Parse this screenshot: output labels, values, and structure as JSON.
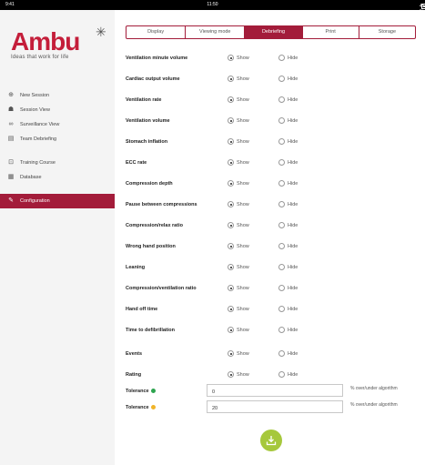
{
  "status": {
    "left": "9:41",
    "time": "11:50",
    "battery": "45 %"
  },
  "brand": {
    "name": "Ambu",
    "tagline": "Ideas that work for life"
  },
  "colors": {
    "brand": "#a31c3a",
    "save_button": "#a6c83c",
    "tolerance_green": "#2ea44f",
    "tolerance_yellow": "#f0b429"
  },
  "menu": [
    {
      "label": "New Session",
      "icon": "plus-circle-icon"
    },
    {
      "label": "Session View",
      "icon": "person-icon"
    },
    {
      "label": "Surveillance View",
      "icon": "binoculars-icon"
    },
    {
      "label": "Team Debriefing",
      "icon": "clipboard-icon"
    },
    {
      "label": "Training Course",
      "icon": "course-icon"
    },
    {
      "label": "Database",
      "icon": "database-icon"
    },
    {
      "label": "Configuration",
      "icon": "wrench-icon",
      "active": true
    }
  ],
  "tabs": [
    {
      "label": "Display"
    },
    {
      "label": "Viewing mode"
    },
    {
      "label": "Debriefing",
      "active": true
    },
    {
      "label": "Print"
    },
    {
      "label": "Storage"
    }
  ],
  "options": {
    "show": "Show",
    "hide": "Hide"
  },
  "rows": [
    {
      "label": "Ventilation minute volume",
      "value": "show"
    },
    {
      "label": "Cardiac output volume",
      "value": "show"
    },
    {
      "label": "Ventilation rate",
      "value": "show"
    },
    {
      "label": "Ventilation volume",
      "value": "show"
    },
    {
      "label": "Stomach inflation",
      "value": "show"
    },
    {
      "label": "ECC rate",
      "value": "show"
    },
    {
      "label": "Compression depth",
      "value": "show"
    },
    {
      "label": "Pause between compressions",
      "value": "show"
    },
    {
      "label": "Compression/relax ratio",
      "value": "show"
    },
    {
      "label": "Wrong hand position",
      "value": "show"
    },
    {
      "label": "Leaning",
      "value": "show"
    },
    {
      "label": "Compression/ventilation ratio",
      "value": "show"
    },
    {
      "label": "Hand off time",
      "value": "show"
    },
    {
      "label": "Time to defibrillation",
      "value": "show"
    },
    {
      "label": "Events",
      "value": "show"
    },
    {
      "label": "Rating",
      "value": "show"
    }
  ],
  "tolerances": [
    {
      "label": "Tolerance",
      "value": "0",
      "hint": "% over/under algorithm",
      "color": "green"
    },
    {
      "label": "Tolerance",
      "value": "20",
      "hint": "% over/under algorithm",
      "color": "yellow"
    }
  ]
}
